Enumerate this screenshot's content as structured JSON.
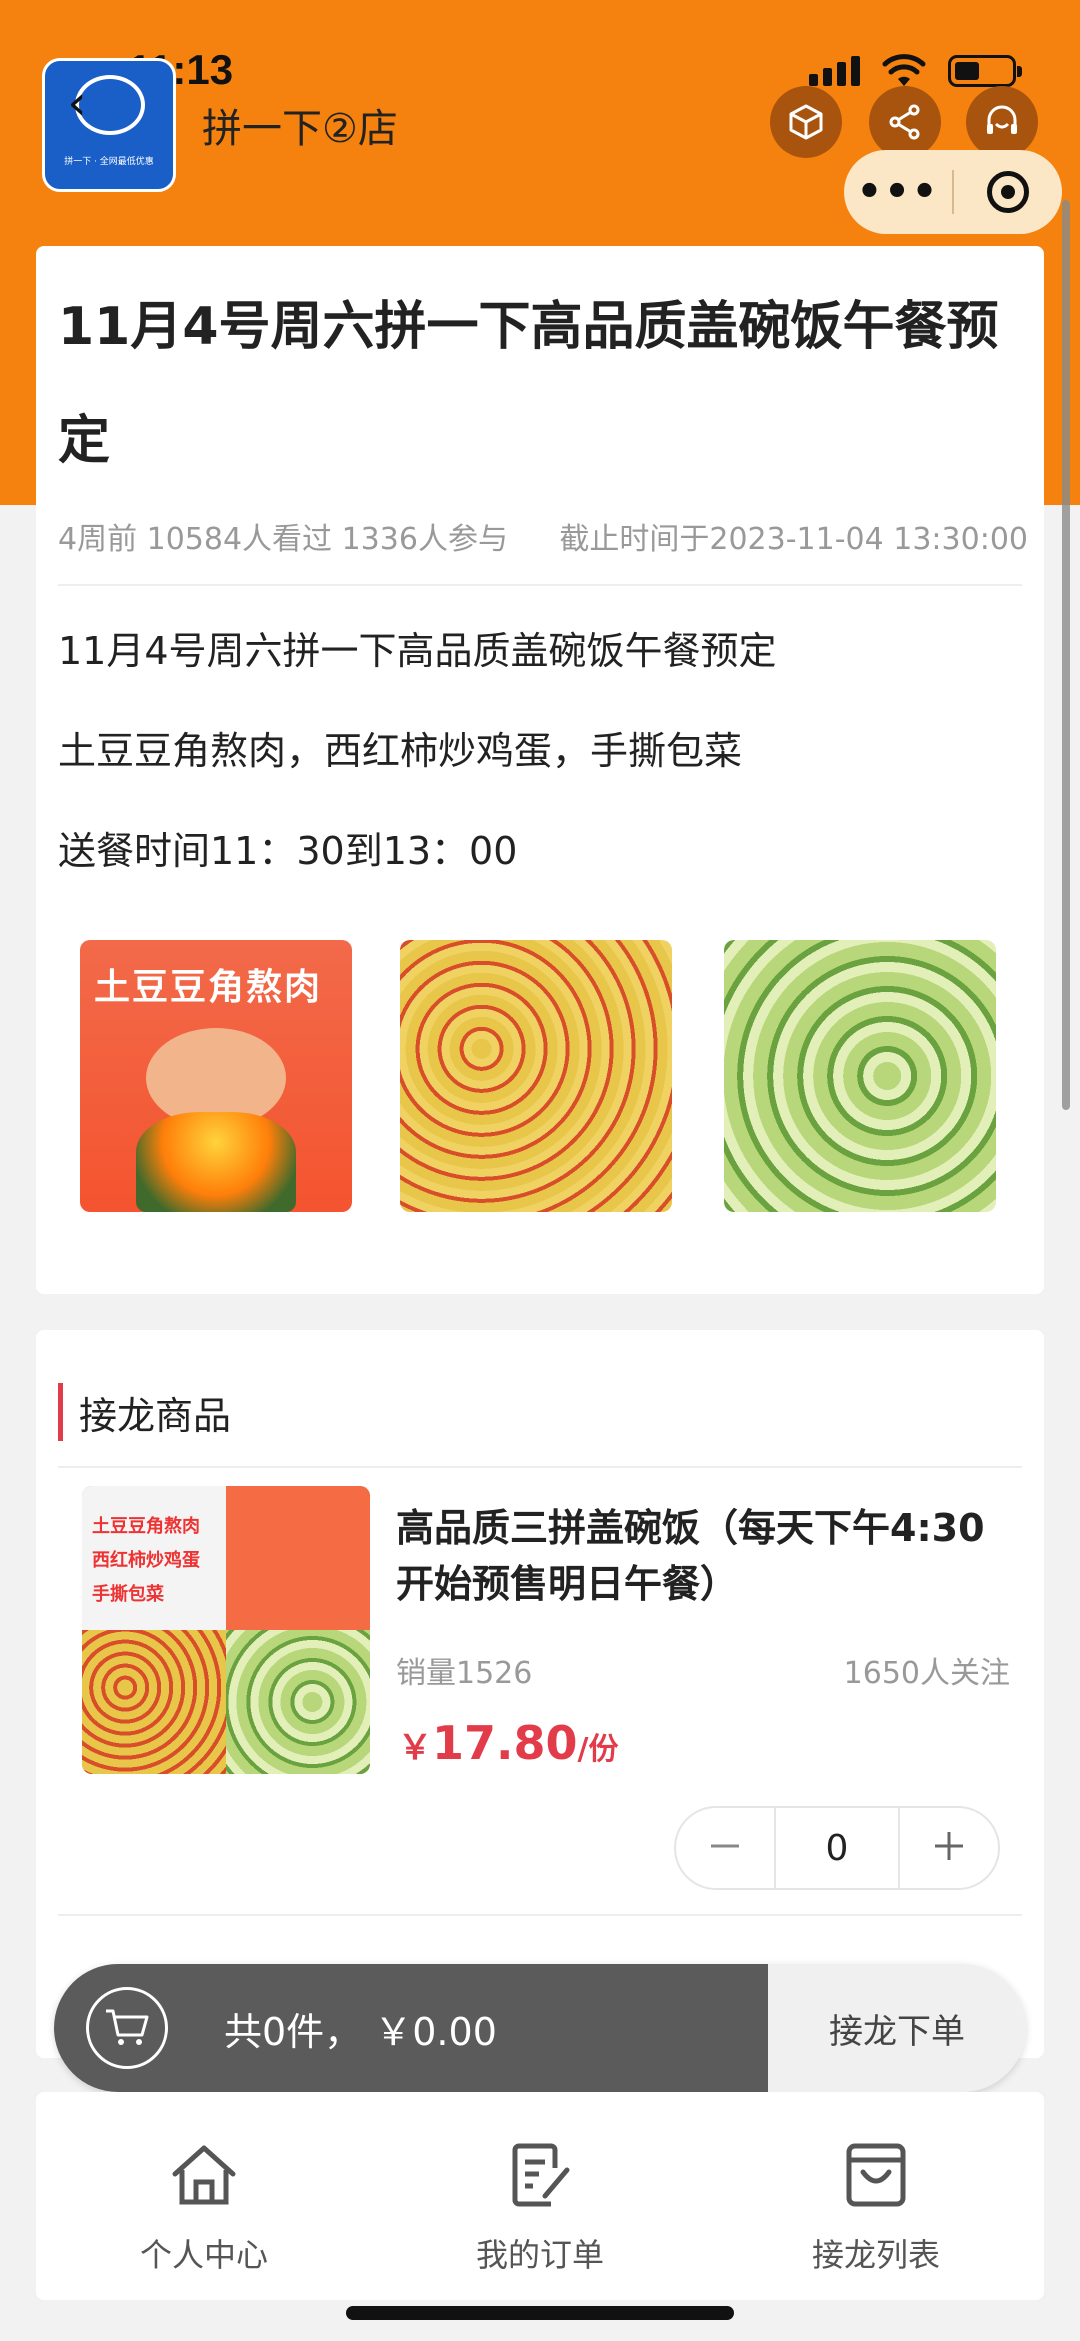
{
  "status_bar": {
    "time": "11:13"
  },
  "header": {
    "store_name": "拼一下②店",
    "logo_slogan": "拼一下 · 全网最低优惠"
  },
  "post": {
    "title": "11月4号周六拼一下高品质盖碗饭午餐预定",
    "meta_left": "4周前 10584人看过 1336人参与",
    "meta_right": "截止时间于2023-11-04 13:30:00",
    "desc_lines": [
      "11月4号周六拼一下高品质盖碗饭午餐预定",
      "土豆豆角熬肉，西红柿炒鸡蛋，手撕包菜",
      "送餐时间11：30到13：00"
    ],
    "image1_label": "土豆豆角熬肉"
  },
  "product_section": {
    "title": "接龙商品",
    "product": {
      "image_lines": [
        "土豆豆角熬肉",
        "西红柿炒鸡蛋",
        "手撕包菜"
      ],
      "name": "高品质三拼盖碗饭（每天下午4:30开始预售明日午餐）",
      "sales": "销量1526",
      "followers": "1650人关注",
      "price_currency": "￥",
      "price": "17.80",
      "price_unit": "/份",
      "quantity": "0"
    }
  },
  "cart": {
    "summary": "共0件，  ￥0.00",
    "checkout_label": "接龙下单"
  },
  "bottom_nav": [
    {
      "label": "个人中心",
      "icon": "home-icon"
    },
    {
      "label": "我的订单",
      "icon": "order-icon"
    },
    {
      "label": "接龙列表",
      "icon": "bag-icon"
    }
  ],
  "colors": {
    "accent": "#f5820e",
    "price": "#e23b4a"
  }
}
